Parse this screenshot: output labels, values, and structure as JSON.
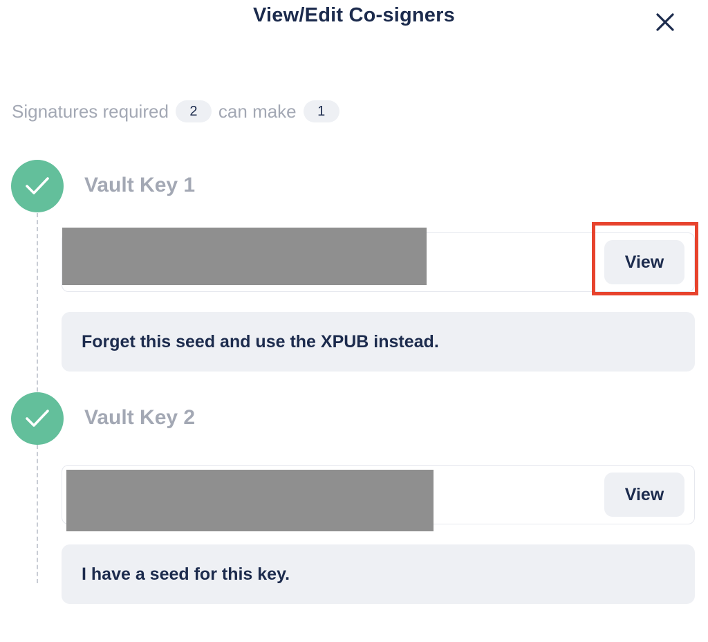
{
  "header": {
    "title": "View/Edit Co-signers",
    "close_icon": "close-icon"
  },
  "signatures": {
    "required_label": "Signatures required",
    "required_count": "2",
    "can_make_label": "can make",
    "can_make_count": "1"
  },
  "keys": [
    {
      "title": "Vault Key 1",
      "status_icon": "check-icon",
      "view_label": "View",
      "option_text": "Forget this seed and use the XPUB instead."
    },
    {
      "title": "Vault Key 2",
      "status_icon": "check-icon",
      "view_label": "View",
      "option_text": "I have a seed for this key."
    }
  ],
  "colors": {
    "accent_green": "#63bf9b",
    "highlight_red": "#e7432d",
    "text_dark": "#1c2b4d",
    "text_muted": "#a3a8b4"
  }
}
